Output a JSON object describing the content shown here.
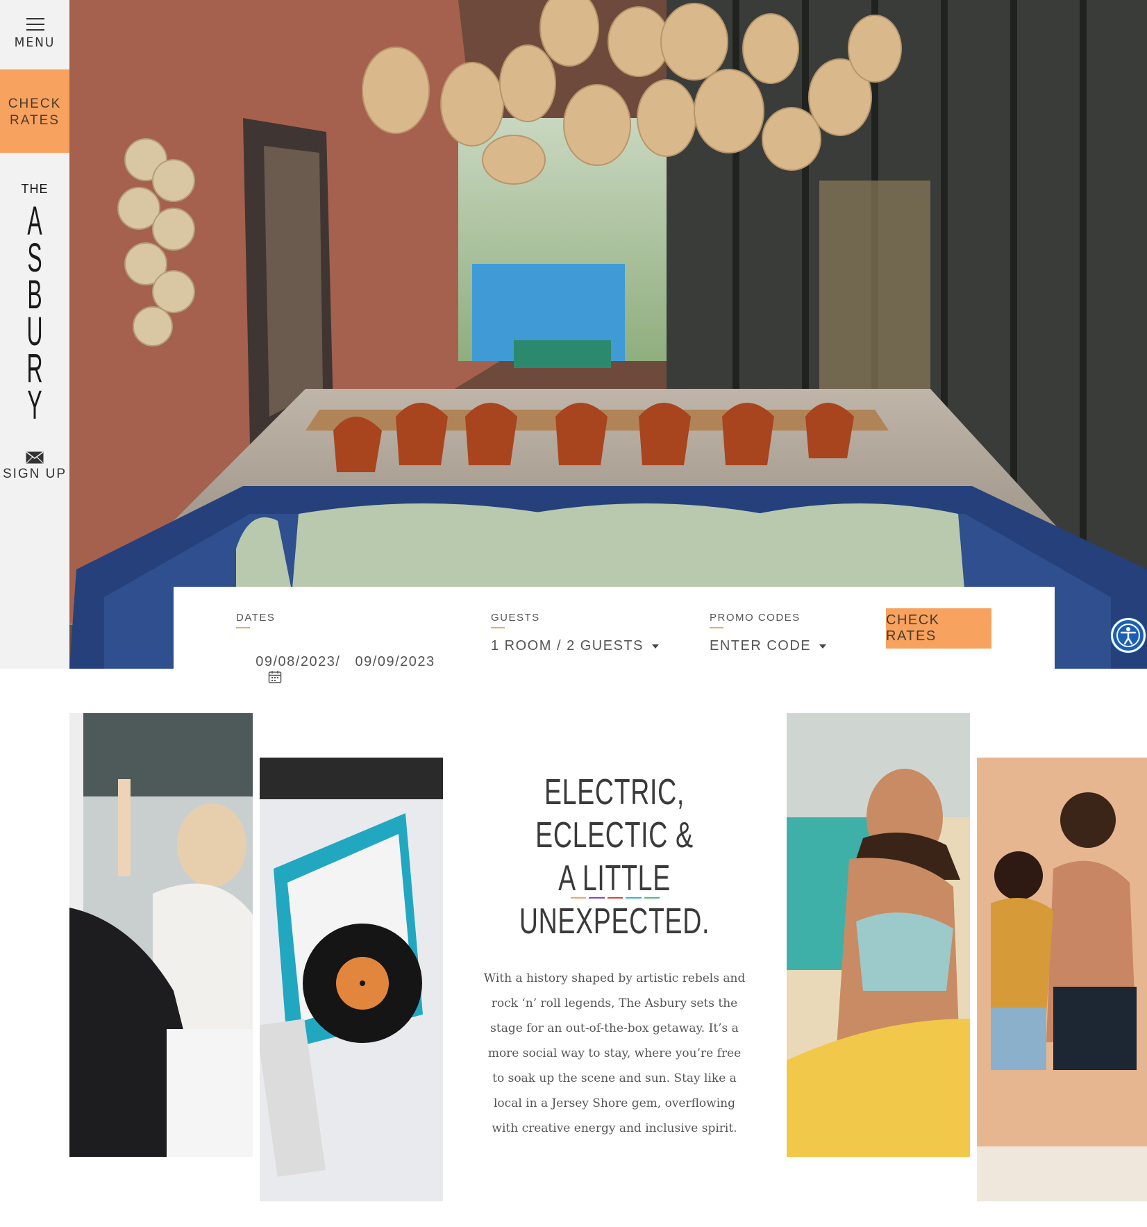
{
  "sidebar": {
    "menu_label": "MENU",
    "check_rates_line1": "CHECK",
    "check_rates_line2": "RATES",
    "logo_the": "THE",
    "logo_word": "ASBURY",
    "signup_label": "SIGN UP"
  },
  "booking": {
    "dates_label": "DATES",
    "dates_value": "09/08/2023/   09/09/2023",
    "guests_label": "GUESTS",
    "guests_value": "1 ROOM / 2 GUESTS",
    "promo_label": "PROMO CODES",
    "promo_value": "ENTER CODE",
    "check_button": "CHECK RATES"
  },
  "intro": {
    "headline_line1": "ELECTRIC, ECLECTIC &",
    "headline_line2": "A LITTLE UNEXPECTED.",
    "paragraph": "With a history shaped by artistic rebels and rock ‘n’ roll legends, The Asbury sets the stage for an out-of-the-box getaway. It’s a more social way to stay, where you’re free to soak up the scene and sun. Stay like a local in a Jersey Shore gem, overflowing with creative energy and inclusive spirit."
  },
  "colors": {
    "accent": "#f7a25e",
    "sidebar_bg": "#f2f2f2",
    "accessibility_blue": "#1a5fb4",
    "divider": [
      "#f7a25e",
      "#8a44c8",
      "#e8403a",
      "#2cb8e0",
      "#4cc07a"
    ]
  },
  "icons": {
    "menu": "hamburger-icon",
    "signup": "envelope-icon",
    "calendar": "calendar-icon",
    "accessibility": "accessibility-icon"
  }
}
